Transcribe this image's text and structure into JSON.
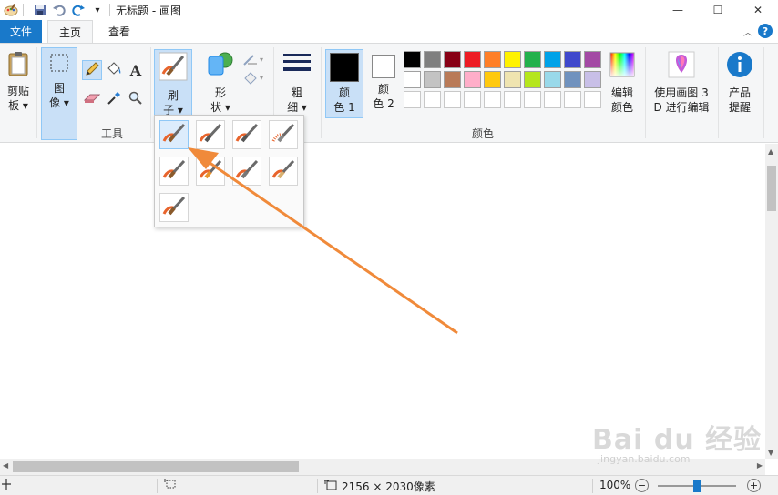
{
  "window": {
    "title": "无标题 - 画图",
    "minimize": "—",
    "maximize": "☐",
    "close": "✕",
    "qat_customize": "▾"
  },
  "tabs": {
    "file": "文件",
    "home": "主页",
    "view": "查看",
    "collapse": "︿",
    "help": "?"
  },
  "ribbon": {
    "clipboard": {
      "line1": "剪贴",
      "line2": "板 ▾"
    },
    "image": {
      "line1": "图",
      "line2": "像 ▾"
    },
    "tools": {
      "group_label": "工具",
      "text_tool": "A"
    },
    "brushes": {
      "line1": "刷",
      "line2": "子 ▾"
    },
    "shapes": {
      "line1": "形",
      "line2": "状 ▾"
    },
    "size": {
      "line1": "粗",
      "line2": "细 ▾"
    },
    "color1": {
      "line1": "颜",
      "line2": "色 1",
      "value": "#000000"
    },
    "color2": {
      "line1": "颜",
      "line2": "色 2",
      "value": "#ffffff"
    },
    "colors_group_label": "颜色",
    "edit_colors": {
      "line1": "编辑",
      "line2": "颜色"
    },
    "paint3d": {
      "line1": "使用画图 3",
      "line2": "D 进行编辑"
    },
    "product_alert": {
      "line1": "产品",
      "line2": "提醒"
    },
    "palette_row1": [
      "#000000",
      "#7f7f7f",
      "#880015",
      "#ed1c24",
      "#ff7f27",
      "#fff200",
      "#22b14c",
      "#00a2e8",
      "#3f48cc",
      "#a349a4"
    ],
    "palette_row2": [
      "#ffffff",
      "#c3c3c3",
      "#b97a57",
      "#ffaec9",
      "#ffc90e",
      "#efe4b0",
      "#b5e61d",
      "#99d9ea",
      "#7092be",
      "#c8bfe7"
    ],
    "palette_row3_count": 10
  },
  "brush_menu": {
    "options": [
      "brush",
      "calligraphy-brush-1",
      "calligraphy-brush-2",
      "airbrush",
      "oil-brush",
      "crayon",
      "marker",
      "natural-pencil",
      "watercolor-brush"
    ]
  },
  "status": {
    "canvas_size": "2156 × 2030像素",
    "zoom": "100%",
    "zoom_minus": "−",
    "zoom_plus": "+"
  },
  "watermark": {
    "brand": "Bai du 经验",
    "url": "jingyan.baidu.com"
  },
  "colors": {
    "accent": "#1979ca",
    "arrow": "#f08a3a"
  }
}
